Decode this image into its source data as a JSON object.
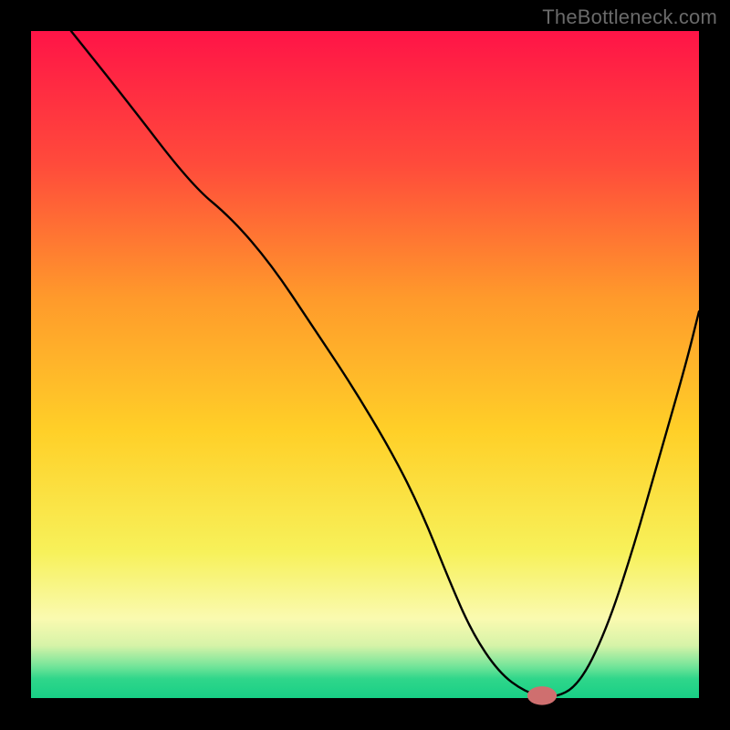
{
  "watermark": "TheBottleneck.com",
  "chart_data": {
    "type": "line",
    "title": "",
    "xlabel": "",
    "ylabel": "",
    "xlim": [
      0,
      100
    ],
    "ylim": [
      0,
      100
    ],
    "grid": false,
    "legend": false,
    "background_gradient": {
      "stops": [
        {
          "offset": 0.0,
          "color": "#ff1447"
        },
        {
          "offset": 0.2,
          "color": "#ff4b3b"
        },
        {
          "offset": 0.4,
          "color": "#ff9a2b"
        },
        {
          "offset": 0.6,
          "color": "#ffd028"
        },
        {
          "offset": 0.78,
          "color": "#f7f15a"
        },
        {
          "offset": 0.88,
          "color": "#fafab0"
        },
        {
          "offset": 0.92,
          "color": "#d6f3a8"
        },
        {
          "offset": 0.95,
          "color": "#77e59a"
        },
        {
          "offset": 0.97,
          "color": "#2fd68a"
        },
        {
          "offset": 1.0,
          "color": "#17cf86"
        }
      ]
    },
    "series": [
      {
        "name": "bottleneck-curve",
        "x": [
          6,
          14,
          24,
          30,
          36,
          42,
          48,
          54,
          58.5,
          62.5,
          66,
          70,
          74,
          78,
          82,
          86,
          90,
          94,
          98,
          100
        ],
        "y": [
          100,
          90,
          77,
          72,
          65,
          56,
          47,
          37,
          28,
          18,
          10,
          4,
          1,
          0,
          2,
          10,
          22,
          36,
          50,
          58
        ]
      }
    ],
    "marker": {
      "name": "optimal-point",
      "x": 76.5,
      "y": 0.5,
      "rx": 2.2,
      "ry": 1.4,
      "color": "#cf6f6f"
    }
  }
}
